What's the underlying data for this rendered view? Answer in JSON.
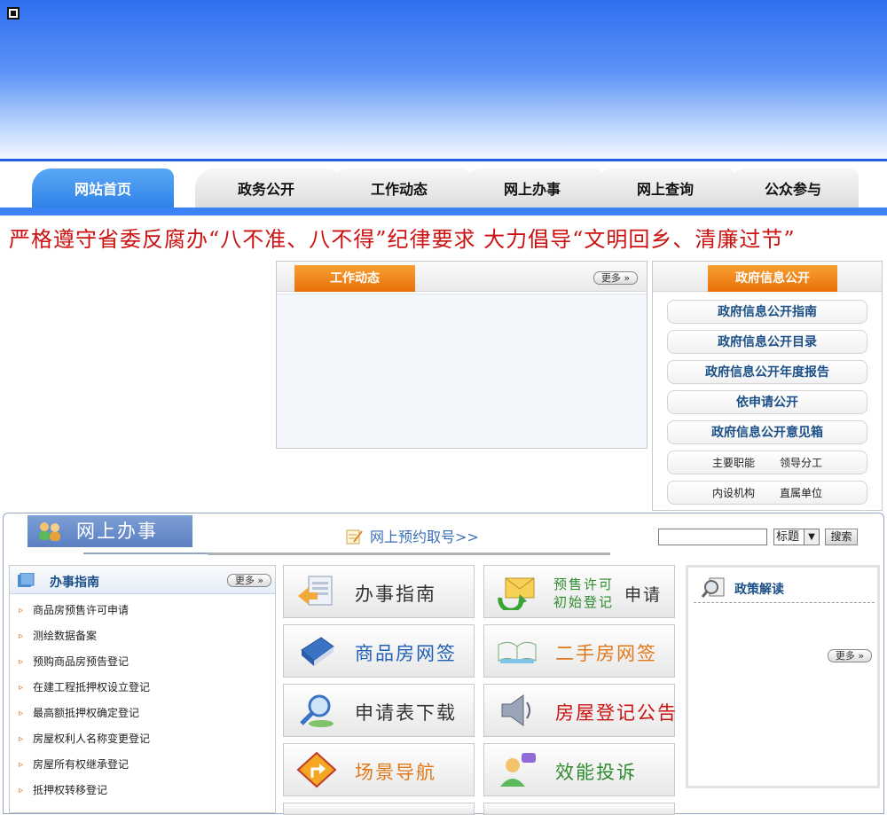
{
  "header": {
    "logo_icon": "window-icon"
  },
  "nav": {
    "tabs": [
      "网站首页",
      "政务公开",
      "工作动态",
      "网上办事",
      "网上查询",
      "公众参与"
    ],
    "active": "网站首页"
  },
  "notice": {
    "text": "严格遵守省委反腐办“八不准、八不得”纪律要求  大力倡导“文明回乡、清廉过节”"
  },
  "work_news": {
    "title": "工作动态",
    "more": "更多"
  },
  "gov_info": {
    "title": "政府信息公开",
    "links": [
      "政府信息公开指南",
      "政府信息公开目录",
      "政府信息公开年度报告",
      "依申请公开",
      "政府信息公开意见箱"
    ],
    "small_links": [
      [
        "主要职能",
        "领导分工"
      ],
      [
        "内设机构",
        "直属单位"
      ]
    ]
  },
  "online": {
    "title": "网上办事",
    "appointment": "网上预约取号>>",
    "search": {
      "input_value": "",
      "select_value": "标题",
      "button": "搜索"
    }
  },
  "guide": {
    "title": "办事指南",
    "more": "更多",
    "items": [
      "商品房预售许可申请",
      "测绘数据备案",
      "预购商品房预告登记",
      "在建工程抵押权设立登记",
      "最高额抵押权确定登记",
      "房屋权利人名称变更登记",
      "房屋所有权继承登记",
      "抵押权转移登记"
    ]
  },
  "tiles": {
    "t1": "办事指南",
    "t2a": "预售许可",
    "t2b": "初始登记",
    "t2c": "申请",
    "t3": "商品房网签",
    "t4": "二手房网签",
    "t5": "申请表下载",
    "t6": "房屋登记公告",
    "t7": "场景导航",
    "t8": "效能投诉"
  },
  "policy": {
    "title": "政策解读",
    "more": "更多"
  },
  "colors": {
    "accent_blue": "#3b82f6",
    "orange": "#f08a1a",
    "notice_red": "#cc1111"
  }
}
